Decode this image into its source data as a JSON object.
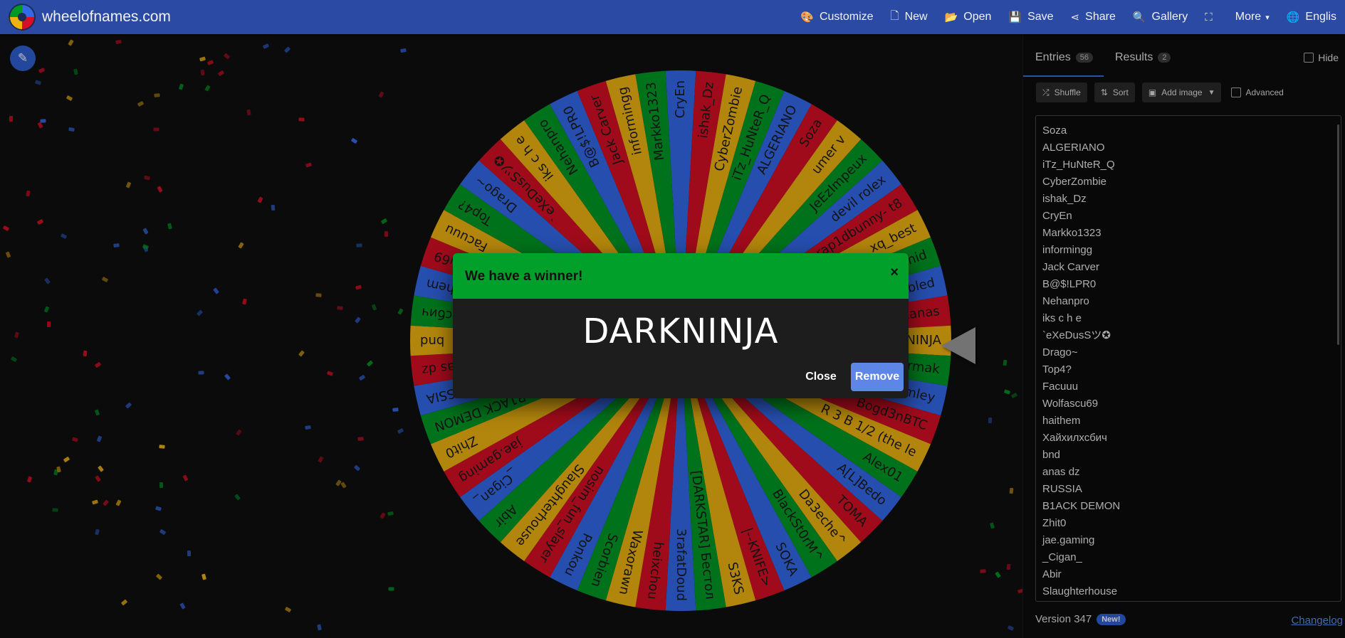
{
  "app": {
    "site_title": "wheelofnames.com"
  },
  "menu": [
    {
      "icon": "palette-icon",
      "glyph": "🎨",
      "label": "Customize"
    },
    {
      "icon": "file-icon",
      "glyph": "🗋",
      "label": "New"
    },
    {
      "icon": "folder-open-icon",
      "glyph": "📂",
      "label": "Open"
    },
    {
      "icon": "save-icon",
      "glyph": "💾",
      "label": "Save"
    },
    {
      "icon": "share-icon",
      "glyph": "⋖",
      "label": "Share"
    },
    {
      "icon": "search-icon",
      "glyph": "🔍",
      "label": "Gallery"
    },
    {
      "icon": "fullscreen-icon",
      "glyph": "⛶",
      "label": ""
    },
    {
      "icon": "more-icon",
      "glyph": "",
      "label": "More",
      "caret": "▾"
    },
    {
      "icon": "globe-icon",
      "glyph": "🌐",
      "label": "Englis"
    }
  ],
  "wheel": {
    "colors": [
      "#3369e8",
      "#d50f25",
      "#eeb211",
      "#009925"
    ],
    "segments": [
      "CryEn",
      "ishak_Dz",
      "CyberZombie",
      "iTz_HuNteR_Q",
      "ALGERIANO",
      "Soza",
      "umer v",
      "JeEzImpeux",
      "devil rolex",
      "rap1dbunny- t8",
      "xq_best",
      "Nahid",
      "Enabled",
      "Zygkanas",
      "DARKNINJA",
      "Hormak",
      "hamley",
      "Bogd3nBTC",
      "R 3 B 1/2 (the le",
      "Alex01",
      "A[L]Bedo",
      "TOMA",
      "Da3eche^",
      "BlackSt0rM^",
      "SOKA",
      "|--KNIFE>",
      "S3KS",
      "[DARKSTAR] Бестол",
      "3rafatDoud",
      "heixchou",
      "Waxorawn",
      "Scorbien",
      "Ponkou",
      "nosim_fun_slayer",
      "Slaughterhouse",
      "Abir",
      "_Cigan_",
      "jae.gaming",
      "Zhit0",
      "B1ACK DEMON",
      "RUSSIA",
      "anas dz",
      "bnd",
      "Хайхилхсбич",
      "haithem",
      "Wolfascu69",
      "Facuuu",
      "Top4?",
      "Drago~",
      "`eXeDusSツ✪",
      "iks c h e",
      "Nehanpro",
      "B@$!LPR0",
      "Jack Carver",
      "informingg",
      "Markko1323"
    ]
  },
  "dialog": {
    "title": "We have a winner!",
    "close_x": "×",
    "winner": "DARKNINJA",
    "close_label": "Close",
    "remove_label": "Remove"
  },
  "side": {
    "tabs": {
      "entries_label": "Entries",
      "entries_count": "56",
      "results_label": "Results",
      "results_count": "2"
    },
    "hide_label": "Hide",
    "tools": {
      "shuffle_label": "Shuffle",
      "sort_label": "Sort",
      "add_image_label": "Add image",
      "advanced_label": "Advanced"
    },
    "entries": [
      "Soza",
      "ALGERIANO",
      "iTz_HuNteR_Q",
      "CyberZombie",
      "ishak_Dz",
      "CryEn",
      "Markko1323",
      "informingg",
      "Jack Carver",
      "B@$!LPR0",
      "Nehanpro",
      "iks c h e",
      "`eXeDusSツ✪",
      "Drago~",
      "Top4?",
      "Facuuu",
      "Wolfascu69",
      "haithem",
      "Хайхилхсбич",
      "bnd",
      "anas dz",
      "RUSSIA",
      "B1ACK DEMON",
      "Zhit0",
      "jae.gaming",
      "_Cigan_",
      "Abir",
      "Slaughterhouse"
    ],
    "version_label": "Version 347",
    "new_badge": "New!",
    "changelog_label": "Changelog"
  }
}
